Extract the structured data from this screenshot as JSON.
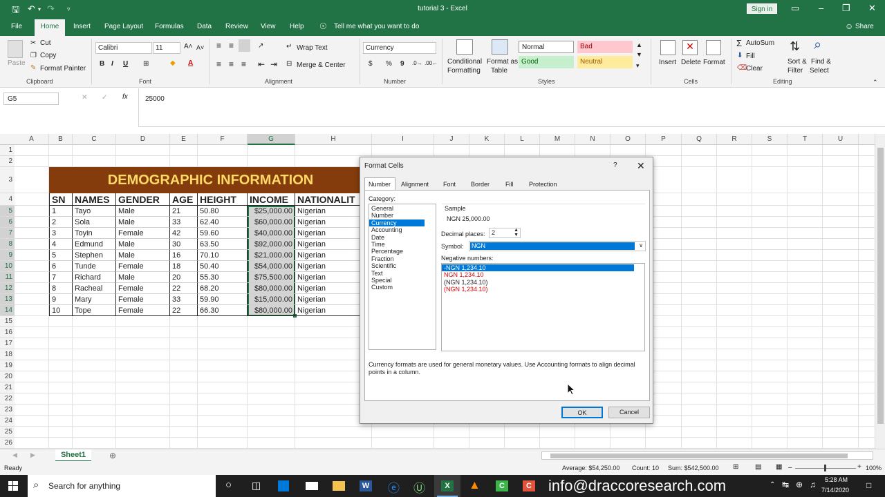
{
  "window": {
    "title": "tutorial 3  -  Excel",
    "signin": "Sign in"
  },
  "menu": [
    "File",
    "Home",
    "Insert",
    "Page Layout",
    "Formulas",
    "Data",
    "Review",
    "View",
    "Help"
  ],
  "tell_me": "Tell me what you want to do",
  "share": "Share",
  "ribbon": {
    "clipboard": {
      "paste": "Paste",
      "cut": "Cut",
      "copy": "Copy",
      "format_painter": "Format Painter",
      "label": "Clipboard"
    },
    "font": {
      "name": "Calibri",
      "size": "11",
      "label": "Font",
      "bold": "B",
      "italic": "I",
      "underline": "U"
    },
    "alignment": {
      "wrap": "Wrap Text",
      "merge": "Merge & Center",
      "label": "Alignment"
    },
    "number": {
      "format": "Currency",
      "label": "Number",
      "dollar": "$",
      "percent": "%",
      "comma": "9"
    },
    "styles": {
      "cond": "Conditional",
      "cond2": "Formatting",
      "fmt_table": "Format as",
      "fmt_table2": "Table",
      "normal": "Normal",
      "bad": "Bad",
      "good": "Good",
      "neutral": "Neutral",
      "label": "Styles"
    },
    "cells": {
      "insert": "Insert",
      "delete": "Delete",
      "format": "Format",
      "label": "Cells"
    },
    "editing": {
      "autosum": "AutoSum",
      "fill": "Fill",
      "clear": "Clear",
      "sort": "Sort &",
      "sort2": "Filter",
      "find": "Find &",
      "find2": "Select",
      "label": "Editing"
    }
  },
  "formula_bar": {
    "name_box": "G5",
    "value": "25000"
  },
  "columns": [
    "A",
    "B",
    "C",
    "D",
    "E",
    "F",
    "G",
    "H",
    "I",
    "J",
    "K",
    "L",
    "M",
    "N",
    "O",
    "P",
    "Q",
    "R",
    "S",
    "T",
    "U"
  ],
  "rows": [
    "1",
    "2",
    "3",
    "4",
    "5",
    "6",
    "7",
    "8",
    "9",
    "10",
    "11",
    "12",
    "13",
    "14",
    "15",
    "16",
    "17",
    "18",
    "19",
    "20",
    "21",
    "22",
    "23",
    "24",
    "25",
    "26"
  ],
  "sheet": {
    "banner": "DEMOGRAPHIC INFORMATION",
    "headers": [
      "SN",
      "NAMES",
      "GENDER",
      "AGE",
      "HEIGHT",
      "INCOME",
      "NATIONALIT"
    ],
    "rows": [
      [
        "1",
        "Tayo",
        "Male",
        "21",
        "50.80",
        "$25,000.00",
        "Nigerian"
      ],
      [
        "2",
        "Sola",
        "Male",
        "33",
        "62.40",
        "$60,000.00",
        "Nigerian"
      ],
      [
        "3",
        "Toyin",
        "Female",
        "42",
        "59.60",
        "$40,000.00",
        "Nigerian"
      ],
      [
        "4",
        "Edmund",
        "Male",
        "30",
        "63.50",
        "$92,000.00",
        "Nigerian"
      ],
      [
        "5",
        "Stephen",
        "Male",
        "16",
        "70.10",
        "$21,000.00",
        "Nigerian"
      ],
      [
        "6",
        "Tunde",
        "Female",
        "18",
        "50.40",
        "$54,000.00",
        "Nigerian"
      ],
      [
        "7",
        "Richard",
        "Male",
        "20",
        "55.30",
        "$75,500.00",
        "Nigerian"
      ],
      [
        "8",
        "Racheal",
        "Female",
        "22",
        "68.20",
        "$80,000.00",
        "Nigerian"
      ],
      [
        "9",
        "Mary",
        "Female",
        "33",
        "59.90",
        "$15,000.00",
        "Nigerian"
      ],
      [
        "10",
        "Tope",
        "Female",
        "22",
        "66.30",
        "$80,000.00",
        "Nigerian"
      ]
    ]
  },
  "dialog": {
    "title": "Format Cells",
    "help": "?",
    "tabs": [
      "Number",
      "Alignment",
      "Font",
      "Border",
      "Fill",
      "Protection"
    ],
    "category_label": "Category:",
    "categories": [
      "General",
      "Number",
      "Currency",
      "Accounting",
      "Date",
      "Time",
      "Percentage",
      "Fraction",
      "Scientific",
      "Text",
      "Special",
      "Custom"
    ],
    "selected_category": "Currency",
    "sample_label": "Sample",
    "sample_value": "NGN 25,000.00",
    "decimal_label": "Decimal places:",
    "decimal_value": "2",
    "symbol_label": "Symbol:",
    "symbol_value": "NGN",
    "negative_label": "Negative numbers:",
    "negatives": [
      "-NGN 1,234.10",
      "NGN 1,234.10",
      "(NGN 1,234.10)",
      "(NGN 1,234.10)"
    ],
    "description": "Currency formats are used for general monetary values.  Use Accounting formats to align decimal points in a column.",
    "ok": "OK",
    "cancel": "Cancel"
  },
  "sheet_tab": "Sheet1",
  "status": {
    "ready": "Ready",
    "average": "Average: $54,250.00",
    "count": "Count: 10",
    "sum": "Sum: $542,500.00",
    "zoom": "100%"
  },
  "taskbar": {
    "search": "Search for anything",
    "watermark": "info@draccoresearch.com",
    "time": "5:28 AM",
    "date": "7/14/2020"
  },
  "colors": {
    "excel_green": "#217346",
    "banner_bg": "#843c0c",
    "banner_text": "#ffd966",
    "selection": "#0078d7"
  }
}
